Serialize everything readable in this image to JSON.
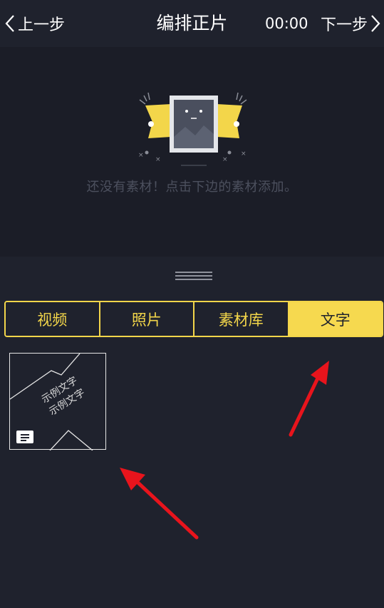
{
  "header": {
    "back_label": "上一步",
    "title": "编排正片",
    "time": "00:00",
    "next_label": "下一步"
  },
  "preview": {
    "empty_message": "还没有素材！点击下边的素材添加。"
  },
  "tabs": [
    {
      "label": "视频",
      "active": false
    },
    {
      "label": "照片",
      "active": false
    },
    {
      "label": "素材库",
      "active": false
    },
    {
      "label": "文字",
      "active": true
    }
  ],
  "text_templates": [
    {
      "lines": [
        "示例文字",
        "示例文字"
      ],
      "icon": "text-lines-icon"
    }
  ],
  "colors": {
    "accent": "#f6d94f",
    "background": "#1f222d",
    "preview_bg": "#1b1d27",
    "annotation_arrow": "#e8141c"
  }
}
